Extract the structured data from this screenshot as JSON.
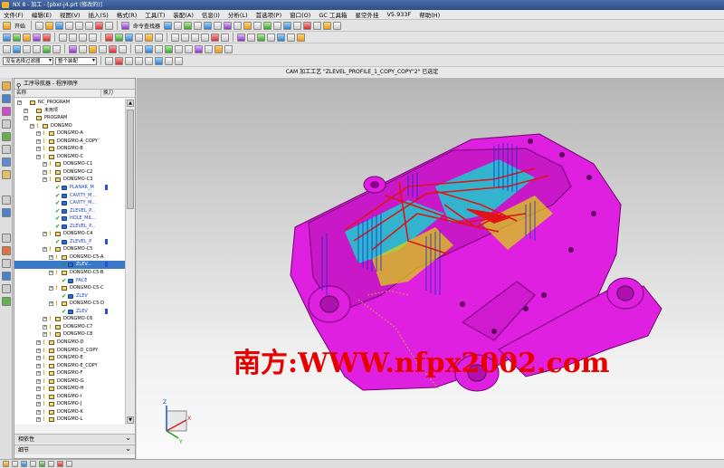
{
  "window": {
    "title": "NX 8 - 加工 - [pbxr-j4.prt (修改的)]"
  },
  "menu": [
    "文件(F)",
    "编辑(E)",
    "视图(V)",
    "插入(S)",
    "格式(R)",
    "工具(T)",
    "装配(A)",
    "信息(I)",
    "分析(L)",
    "首选项(P)",
    "窗口(O)",
    "GC 工具箱",
    "星空外挂",
    "V5.933F",
    "帮助(H)"
  ],
  "toolbar1": {
    "start_label": "开始",
    "command_finder_label": "命令查找器"
  },
  "selection_bar": {
    "filter_value": "没有选择过滤器",
    "scope_value": "整个装配"
  },
  "status": {
    "message": "CAM 加工工艺 \"ZLEVEL_PROFILE_1_COPY_COPY\"2\" 已选定"
  },
  "navigator": {
    "title": "工序导航器 - 程序顺序",
    "col_name": "名称",
    "col_tool": "换刀",
    "rows": [
      {
        "label": "NC_PROGRAM",
        "indent": 0
      },
      {
        "label": "未用项",
        "indent": 1
      },
      {
        "label": "PROGRAM",
        "indent": 1
      },
      {
        "label": "DONGMO",
        "indent": 2
      },
      {
        "label": "DONGMO-A",
        "indent": 3
      },
      {
        "label": "DONGMO-A_COPY",
        "indent": 3
      },
      {
        "label": "DONGMO-B",
        "indent": 3
      },
      {
        "label": "DONGMO-C",
        "indent": 3
      },
      {
        "label": "DONGMO-C1",
        "indent": 4
      },
      {
        "label": "DONGMO-C2",
        "indent": 4
      },
      {
        "label": "DONGMO-C3",
        "indent": 4
      },
      {
        "label": "PLANAR_M",
        "indent": 5,
        "op": true,
        "tool": true
      },
      {
        "label": "CAVITY_M...",
        "indent": 5,
        "op": true
      },
      {
        "label": "CAVITY_M...",
        "indent": 5,
        "op": true
      },
      {
        "label": "ZLEVEL_P...",
        "indent": 5,
        "op": true
      },
      {
        "label": "HOLE_MIL...",
        "indent": 5,
        "op": true
      },
      {
        "label": "ZLEVEL_P...",
        "indent": 5,
        "op": true
      },
      {
        "label": "DONGMO-C4",
        "indent": 4
      },
      {
        "label": "ZLEVEL_P",
        "indent": 5,
        "op": true,
        "tool": true
      },
      {
        "label": "DONGMO-C5",
        "indent": 4
      },
      {
        "label": "DONGMO-C5-A",
        "indent": 5
      },
      {
        "label": "ZLEV...",
        "indent": 6,
        "op": true,
        "tool": true,
        "selected": true
      },
      {
        "label": "DONGMO-C5-B",
        "indent": 5
      },
      {
        "label": "FACE",
        "indent": 6,
        "op": true
      },
      {
        "label": "DONGMO-C5-C",
        "indent": 5
      },
      {
        "label": "ZLEV",
        "indent": 6,
        "op": true
      },
      {
        "label": "DONGMO-C5-D",
        "indent": 5
      },
      {
        "label": "ZLEV",
        "indent": 6,
        "op": true,
        "tool": true
      },
      {
        "label": "DONGMO-C6",
        "indent": 4
      },
      {
        "label": "DONGMO-C7",
        "indent": 4
      },
      {
        "label": "DONGMO-C8",
        "indent": 4
      },
      {
        "label": "DONGMO-D",
        "indent": 3
      },
      {
        "label": "DONGMO-D_COPY",
        "indent": 3
      },
      {
        "label": "DONGMO-E",
        "indent": 3
      },
      {
        "label": "DONGMO-E_COPY",
        "indent": 3
      },
      {
        "label": "DONGMO-F",
        "indent": 3
      },
      {
        "label": "DONGMO-G",
        "indent": 3
      },
      {
        "label": "DONGMO-H",
        "indent": 3
      },
      {
        "label": "DONGMO-I",
        "indent": 3
      },
      {
        "label": "DONGMO-J",
        "indent": 3
      },
      {
        "label": "DONGMO-K",
        "indent": 3
      },
      {
        "label": "DONGMO-L",
        "indent": 3
      }
    ],
    "panel_deps": "相依性",
    "panel_details": "细节"
  },
  "viewport": {
    "watermark": "南方:WWW.nfpx2002.com",
    "part_color": "#e020e0",
    "toolpath_color": "#e01414",
    "background_top": "#b6b6b6",
    "background_bottom": "#fafafa",
    "triad": {
      "x_label": "X",
      "y_label": "Y",
      "z_label": "Z"
    }
  }
}
